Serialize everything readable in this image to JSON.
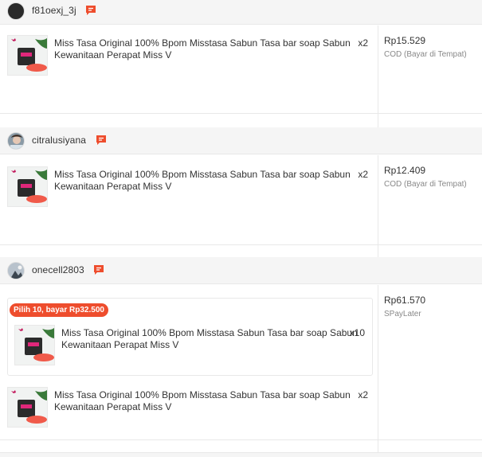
{
  "colors": {
    "accent": "#ee4d2d",
    "header_bg": "#f5f5f5"
  },
  "orders": [
    {
      "username": "f81oexj_3j",
      "items": [
        {
          "name": "Miss Tasa Original 100% Bpom Misstasa Sabun Tasa bar soap Sabun Kewanitaan Perapat Miss V",
          "qty": "x2"
        }
      ],
      "price": "Rp15.529",
      "payment": "COD (Bayar di Tempat)"
    },
    {
      "username": "citralusiyana",
      "items": [
        {
          "name": "Miss Tasa Original 100% Bpom Misstasa Sabun Tasa bar soap Sabun Kewanitaan Perapat Miss V",
          "qty": "x2"
        }
      ],
      "price": "Rp12.409",
      "payment": "COD (Bayar di Tempat)"
    },
    {
      "username": "onecell2803",
      "bundle": {
        "label": "Pilih 10, bayar Rp32.500",
        "item": {
          "name": "Miss Tasa Original 100% Bpom Misstasa Sabun Tasa bar soap Sabun Kewanitaan Perapat Miss V",
          "qty": "x10"
        }
      },
      "items": [
        {
          "name": "Miss Tasa Original 100% Bpom Misstasa Sabun Tasa bar soap Sabun Kewanitaan Perapat Miss V",
          "qty": "x2"
        }
      ],
      "price": "Rp61.570",
      "payment": "SPayLater"
    }
  ]
}
